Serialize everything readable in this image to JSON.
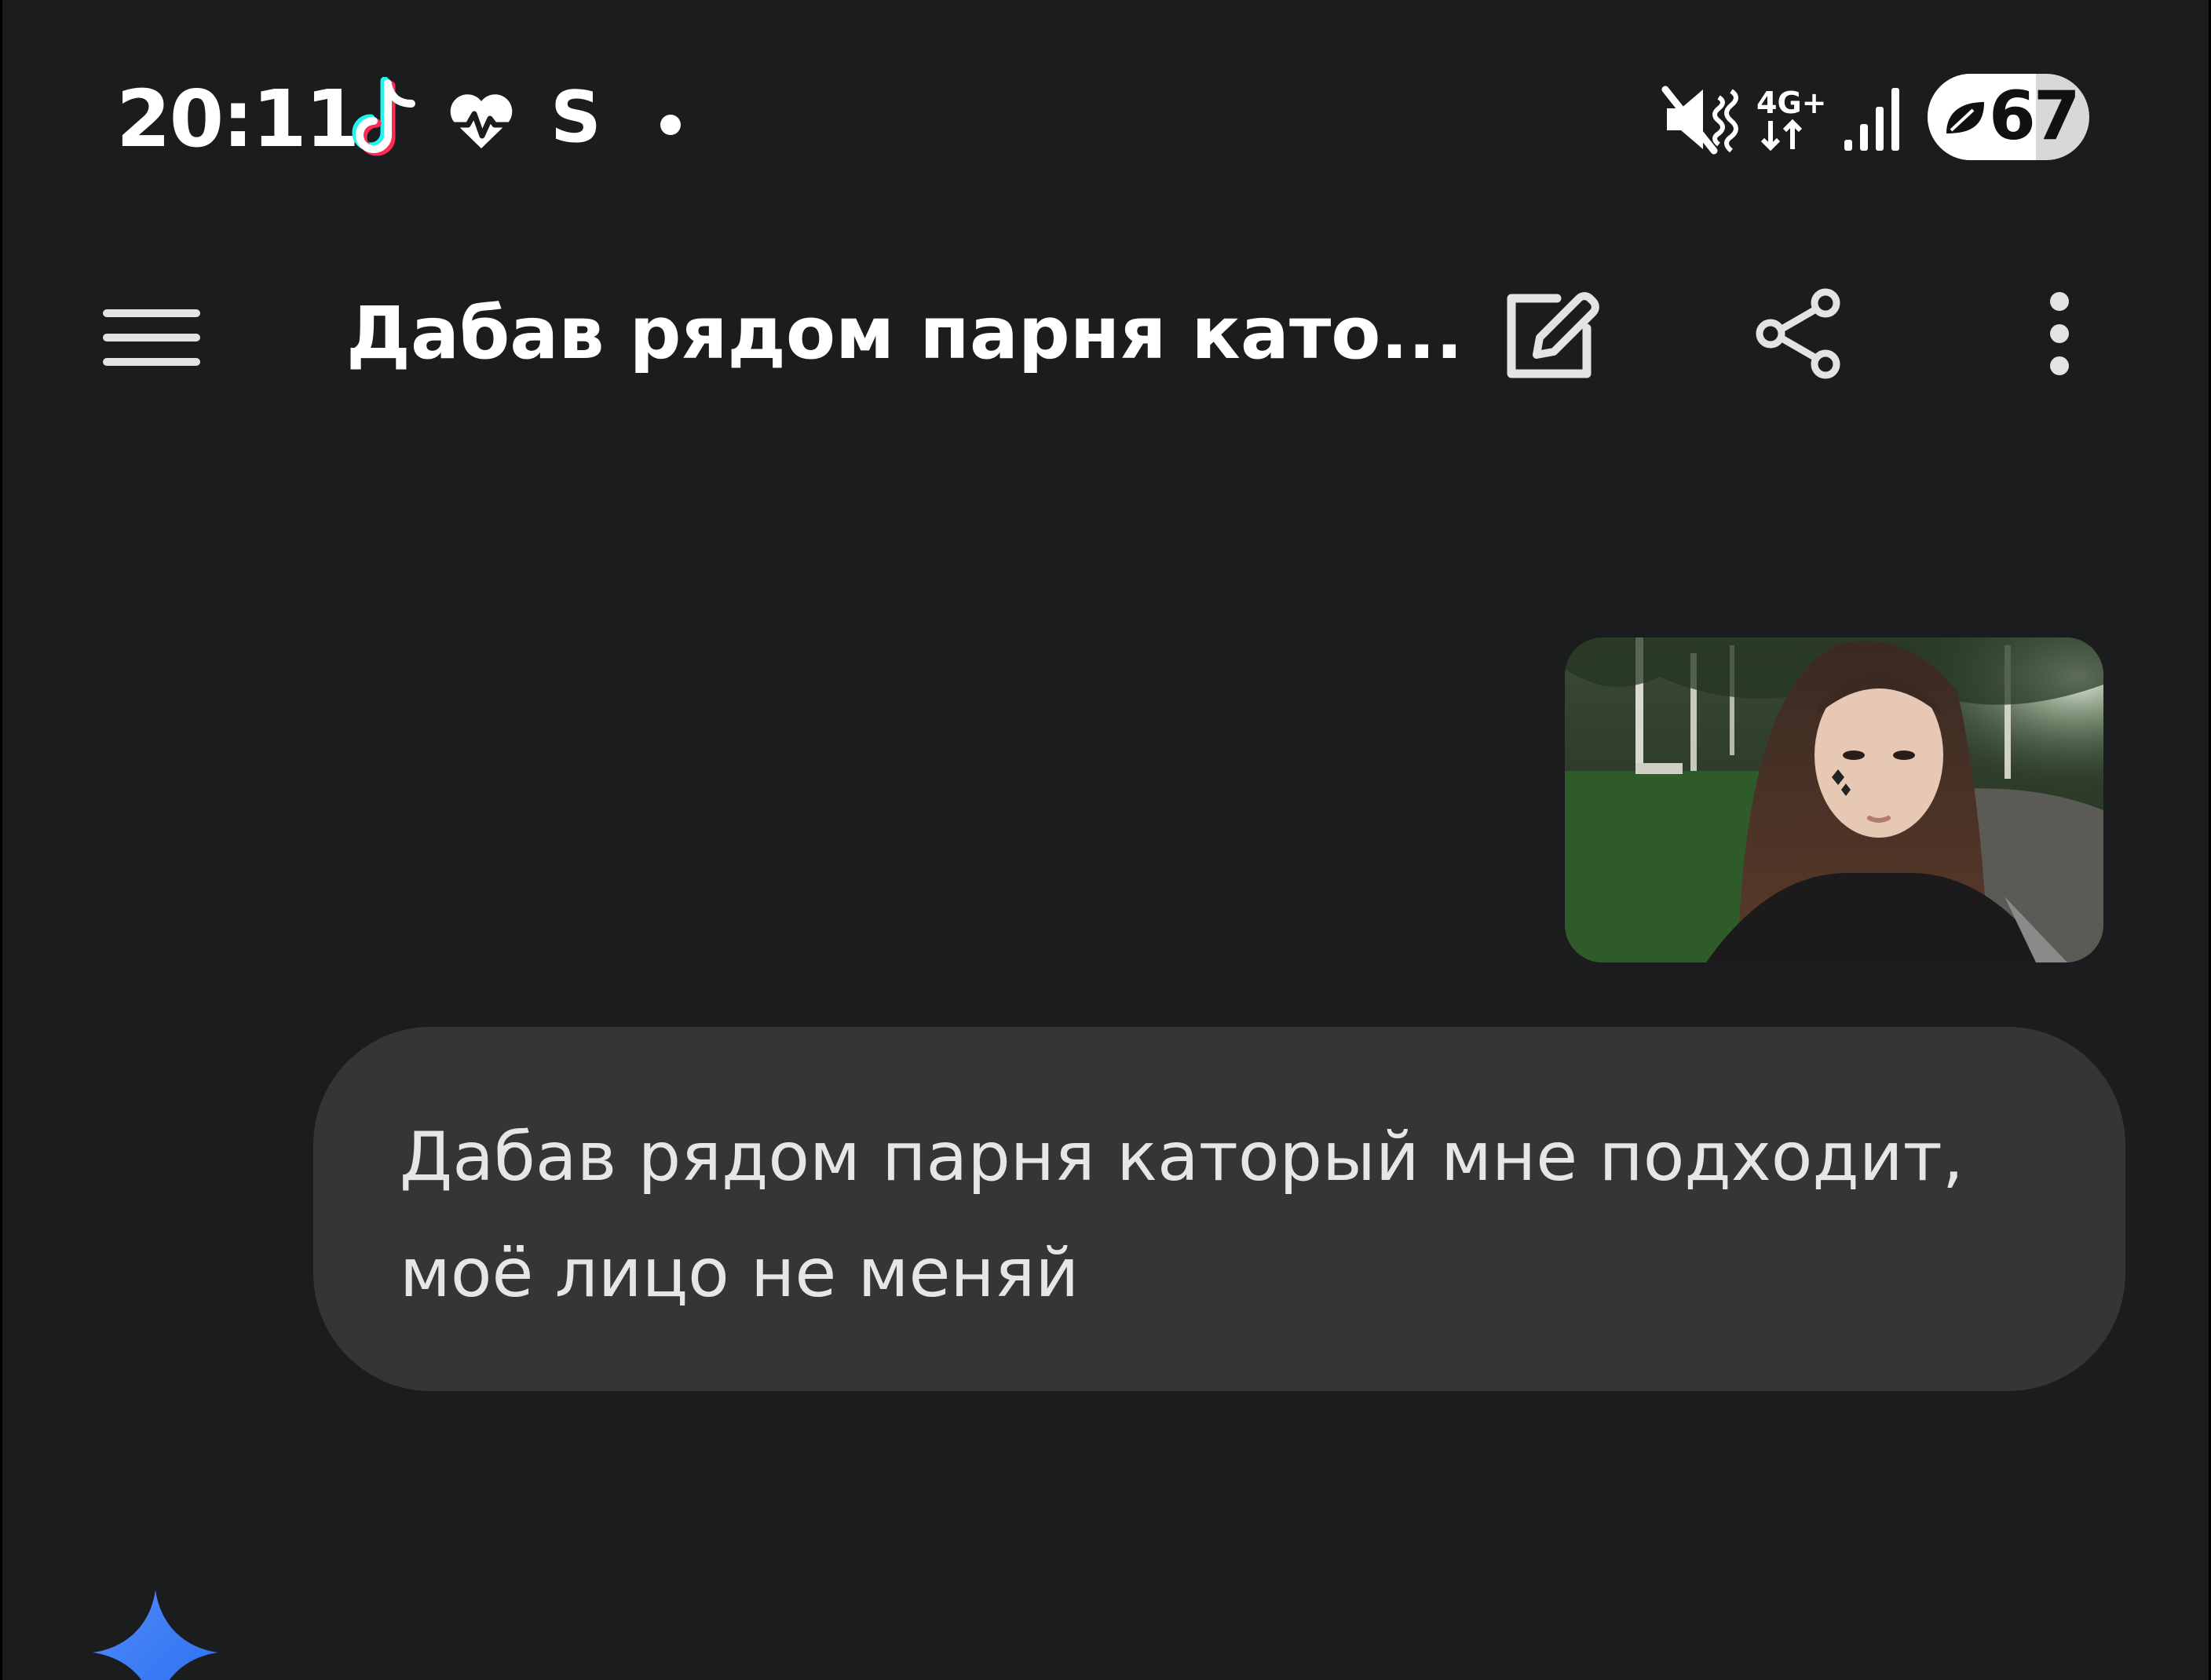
{
  "status_bar": {
    "time": "20:11",
    "notification_icons": [
      "tiktok-icon",
      "heart-rate-icon",
      "s-icon",
      "dot-icon"
    ],
    "s_label": "S",
    "network_label": "4G+",
    "battery_level": "67",
    "battery_percent": 67,
    "icons": [
      "mute-icon",
      "network-4g-icon",
      "signal-icon",
      "battery-saver-icon"
    ]
  },
  "app_bar": {
    "title": "Дабав рядом парня като...",
    "icons": [
      "menu-icon",
      "edit-icon",
      "share-icon",
      "more-vert-icon"
    ]
  },
  "conversation": {
    "user_message": "Дабав рядом парня каторый мне подходит, моё лицо не меняй",
    "assistant_icon": "gemini-sparkle-icon"
  },
  "colors": {
    "background": "#1b1c1e",
    "bubble": "#333537",
    "text": "#e6e6e6",
    "accent_blue": "#4285f4"
  }
}
